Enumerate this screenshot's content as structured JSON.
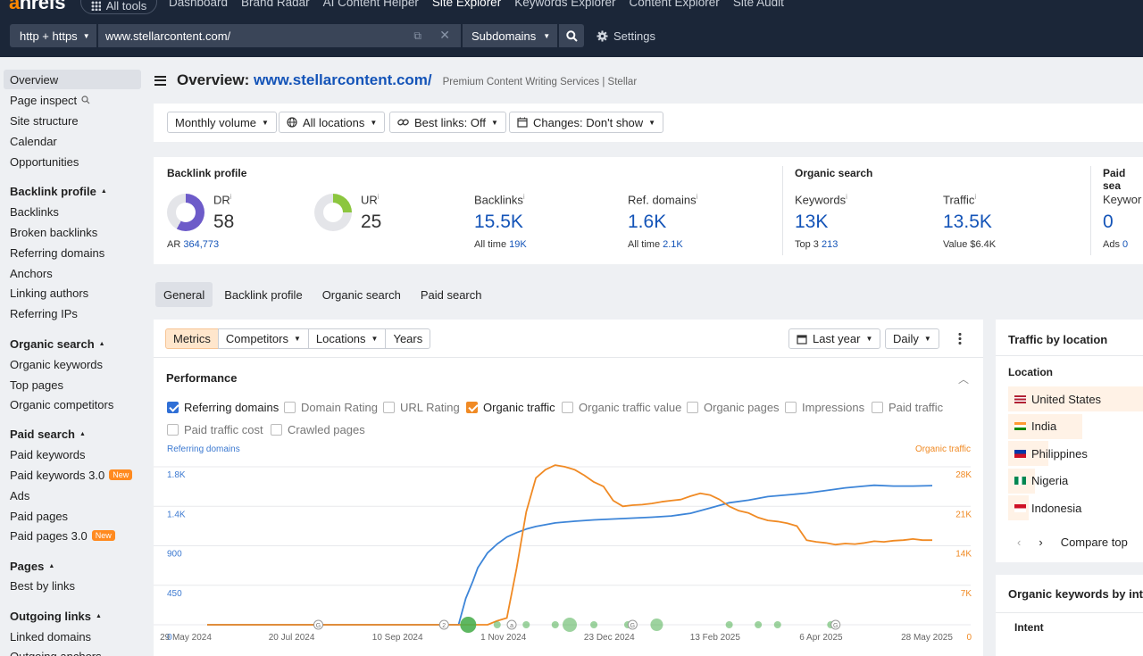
{
  "brand": {
    "logo_prefix": "a",
    "logo_rest": "hrefs"
  },
  "topnav": {
    "all_tools": "All tools",
    "links": [
      "Dashboard",
      "Brand Radar",
      "AI Content Helper",
      "Site Explorer",
      "Keywords Explorer",
      "Content Explorer",
      "Site Audit"
    ],
    "active": "Site Explorer"
  },
  "searchbar": {
    "protocol": "http + https",
    "url": "www.stellarcontent.com/",
    "mode": "Subdomains",
    "settings": "Settings"
  },
  "sidebar": {
    "items": [
      {
        "label": "Overview",
        "type": "item",
        "active": true
      },
      {
        "label": "Page inspect",
        "type": "item",
        "icon": "search-icon"
      },
      {
        "label": "Site structure",
        "type": "item"
      },
      {
        "label": "Calendar",
        "type": "item"
      },
      {
        "label": "Opportunities",
        "type": "item"
      },
      {
        "label": "Backlink profile",
        "type": "head"
      },
      {
        "label": "Backlinks",
        "type": "item"
      },
      {
        "label": "Broken backlinks",
        "type": "item"
      },
      {
        "label": "Referring domains",
        "type": "item"
      },
      {
        "label": "Anchors",
        "type": "item"
      },
      {
        "label": "Linking authors",
        "type": "item"
      },
      {
        "label": "Referring IPs",
        "type": "item"
      },
      {
        "label": "Organic search",
        "type": "head"
      },
      {
        "label": "Organic keywords",
        "type": "item"
      },
      {
        "label": "Top pages",
        "type": "item"
      },
      {
        "label": "Organic competitors",
        "type": "item"
      },
      {
        "label": "Paid search",
        "type": "head"
      },
      {
        "label": "Paid keywords",
        "type": "item"
      },
      {
        "label": "Paid keywords 3.0",
        "type": "item",
        "badge": "New"
      },
      {
        "label": "Ads",
        "type": "item"
      },
      {
        "label": "Paid pages",
        "type": "item"
      },
      {
        "label": "Paid pages 3.0",
        "type": "item",
        "badge": "New"
      },
      {
        "label": "Pages",
        "type": "head"
      },
      {
        "label": "Best by links",
        "type": "item"
      },
      {
        "label": "Outgoing links",
        "type": "head"
      },
      {
        "label": "Linked domains",
        "type": "item"
      },
      {
        "label": "Outgoing anchors",
        "type": "item"
      }
    ]
  },
  "header": {
    "title_prefix": "Overview:",
    "title_url": "www.stellarcontent.com/",
    "subtitle": "Premium Content Writing Services | Stellar"
  },
  "filters": {
    "volume": "Monthly volume",
    "locations": "All locations",
    "best_links": "Best links: Off",
    "changes": "Changes: Don't show"
  },
  "stats": {
    "backlink_profile_label": "Backlink profile",
    "organic_search_label": "Organic search",
    "paid_search_label": "Paid sea",
    "dr": {
      "label": "DR",
      "value": "58",
      "sub_label": "AR",
      "sub_value": "364,773",
      "fill_fraction": 0.58
    },
    "ur": {
      "label": "UR",
      "value": "25",
      "fill_fraction": 0.25
    },
    "backlinks": {
      "label": "Backlinks",
      "value": "15.5K",
      "sub_label": "All time",
      "sub_value": "19K"
    },
    "ref_domains": {
      "label": "Ref. domains",
      "value": "1.6K",
      "sub_label": "All time",
      "sub_value": "2.1K"
    },
    "keywords": {
      "label": "Keywords",
      "value": "13K",
      "sub_label": "Top 3",
      "sub_value": "213"
    },
    "traffic": {
      "label": "Traffic",
      "value": "13.5K",
      "sub_label": "Value",
      "sub_value": "$6.4K"
    },
    "paid_keywords": {
      "label": "Keywor",
      "value": "0",
      "sub_label": "Ads",
      "sub_value": "0"
    },
    "info_mark": "i"
  },
  "tabs": [
    "General",
    "Backlink profile",
    "Organic search",
    "Paid search"
  ],
  "chart_controls": {
    "segments": [
      "Metrics",
      "Competitors",
      "Locations",
      "Years"
    ],
    "range": "Last year",
    "granularity": "Daily",
    "performance": "Performance"
  },
  "metric_toggles": [
    {
      "label": "Referring domains",
      "checked": true,
      "color": "#2f6fd6"
    },
    {
      "label": "Domain Rating",
      "checked": false
    },
    {
      "label": "URL Rating",
      "checked": false
    },
    {
      "label": "Organic traffic",
      "checked": true,
      "color": "#f08a24"
    },
    {
      "label": "Organic traffic value",
      "checked": false
    },
    {
      "label": "Organic pages",
      "checked": false
    },
    {
      "label": "Impressions",
      "checked": false
    },
    {
      "label": "Paid traffic",
      "checked": false
    },
    {
      "label": "Paid traffic cost",
      "checked": false
    },
    {
      "label": "Crawled pages",
      "checked": false
    }
  ],
  "chart_data": {
    "type": "line",
    "left_axis_title": "Referring domains",
    "right_axis_title": "Organic traffic",
    "left_ticks": [
      "0",
      "450",
      "900",
      "1.4K",
      "1.8K"
    ],
    "right_ticks": [
      "0",
      "7K",
      "14K",
      "21K",
      "28K"
    ],
    "x_ticks": [
      "29 May 2024",
      "20 Jul 2024",
      "10 Sep 2024",
      "1 Nov 2024",
      "23 Dec 2024",
      "13 Feb 2025",
      "6 Apr 2025",
      "28 May 2025"
    ],
    "ylim_left": [
      0,
      1800
    ],
    "ylim_right": [
      0,
      28000
    ],
    "series": [
      {
        "name": "Referring domains",
        "color": "#3d85d8",
        "axis": "left",
        "points": [
          [
            0,
            0
          ],
          [
            0.25,
            0
          ],
          [
            0.5,
            0
          ],
          [
            0.52,
            0
          ],
          [
            0.535,
            300
          ],
          [
            0.55,
            500
          ],
          [
            0.56,
            650
          ],
          [
            0.58,
            820
          ],
          [
            0.6,
            920
          ],
          [
            0.62,
            1000
          ],
          [
            0.64,
            1050
          ],
          [
            0.66,
            1090
          ],
          [
            0.68,
            1120
          ],
          [
            0.7,
            1140
          ],
          [
            0.72,
            1160
          ],
          [
            0.76,
            1180
          ],
          [
            0.8,
            1195
          ],
          [
            0.84,
            1205
          ],
          [
            0.88,
            1215
          ],
          [
            0.92,
            1225
          ],
          [
            0.96,
            1240
          ],
          [
            1.0,
            1270
          ],
          [
            1.04,
            1330
          ],
          [
            1.08,
            1390
          ],
          [
            1.12,
            1420
          ],
          [
            1.16,
            1460
          ],
          [
            1.2,
            1480
          ],
          [
            1.24,
            1500
          ],
          [
            1.28,
            1530
          ],
          [
            1.32,
            1560
          ],
          [
            1.36,
            1580
          ],
          [
            1.38,
            1590
          ],
          [
            1.42,
            1580
          ],
          [
            1.46,
            1580
          ],
          [
            1.5,
            1585
          ]
        ]
      },
      {
        "name": "Organic traffic",
        "color": "#f08a24",
        "axis": "right",
        "points": [
          [
            0,
            0
          ],
          [
            0.05,
            0
          ],
          [
            0.1,
            0
          ],
          [
            0.15,
            0
          ],
          [
            0.2,
            0
          ],
          [
            0.25,
            0
          ],
          [
            0.3,
            0
          ],
          [
            0.35,
            0
          ],
          [
            0.4,
            0
          ],
          [
            0.45,
            0
          ],
          [
            0.5,
            0
          ],
          [
            0.55,
            0
          ],
          [
            0.58,
            0
          ],
          [
            0.6,
            700
          ],
          [
            0.62,
            1200
          ],
          [
            0.64,
            10000
          ],
          [
            0.66,
            20000
          ],
          [
            0.68,
            26000
          ],
          [
            0.7,
            27500
          ],
          [
            0.72,
            28300
          ],
          [
            0.74,
            28000
          ],
          [
            0.76,
            27500
          ],
          [
            0.78,
            26500
          ],
          [
            0.8,
            25300
          ],
          [
            0.82,
            24500
          ],
          [
            0.84,
            22000
          ],
          [
            0.86,
            21000
          ],
          [
            0.88,
            21200
          ],
          [
            0.9,
            21300
          ],
          [
            0.92,
            21500
          ],
          [
            0.94,
            21800
          ],
          [
            0.96,
            22000
          ],
          [
            0.98,
            22200
          ],
          [
            1.0,
            22800
          ],
          [
            1.02,
            23300
          ],
          [
            1.04,
            23000
          ],
          [
            1.06,
            22200
          ],
          [
            1.08,
            21000
          ],
          [
            1.1,
            20200
          ],
          [
            1.12,
            19800
          ],
          [
            1.14,
            19000
          ],
          [
            1.16,
            18500
          ],
          [
            1.18,
            18300
          ],
          [
            1.2,
            18000
          ],
          [
            1.22,
            17500
          ],
          [
            1.24,
            15000
          ],
          [
            1.26,
            14700
          ],
          [
            1.28,
            14500
          ],
          [
            1.3,
            14200
          ],
          [
            1.32,
            14400
          ],
          [
            1.34,
            14300
          ],
          [
            1.36,
            14500
          ],
          [
            1.38,
            14800
          ],
          [
            1.4,
            14700
          ],
          [
            1.42,
            14900
          ],
          [
            1.44,
            15000
          ],
          [
            1.46,
            15200
          ],
          [
            1.48,
            15000
          ],
          [
            1.5,
            15000
          ]
        ]
      }
    ],
    "event_markers": [
      "G",
      "2",
      "a",
      "G",
      "G"
    ],
    "grid": true
  },
  "traffic_by_location": {
    "title": "Traffic by location",
    "column": "Location",
    "rows": [
      {
        "country": "United States",
        "share": 1.0
      },
      {
        "country": "India",
        "share": 0.55
      },
      {
        "country": "Philippines",
        "share": 0.3
      },
      {
        "country": "Nigeria",
        "share": 0.2
      },
      {
        "country": "Indonesia",
        "share": 0.15
      }
    ],
    "compare_label": "Compare top"
  },
  "keywords_by_intent": {
    "title": "Organic keywords by inte",
    "column": "Intent"
  }
}
